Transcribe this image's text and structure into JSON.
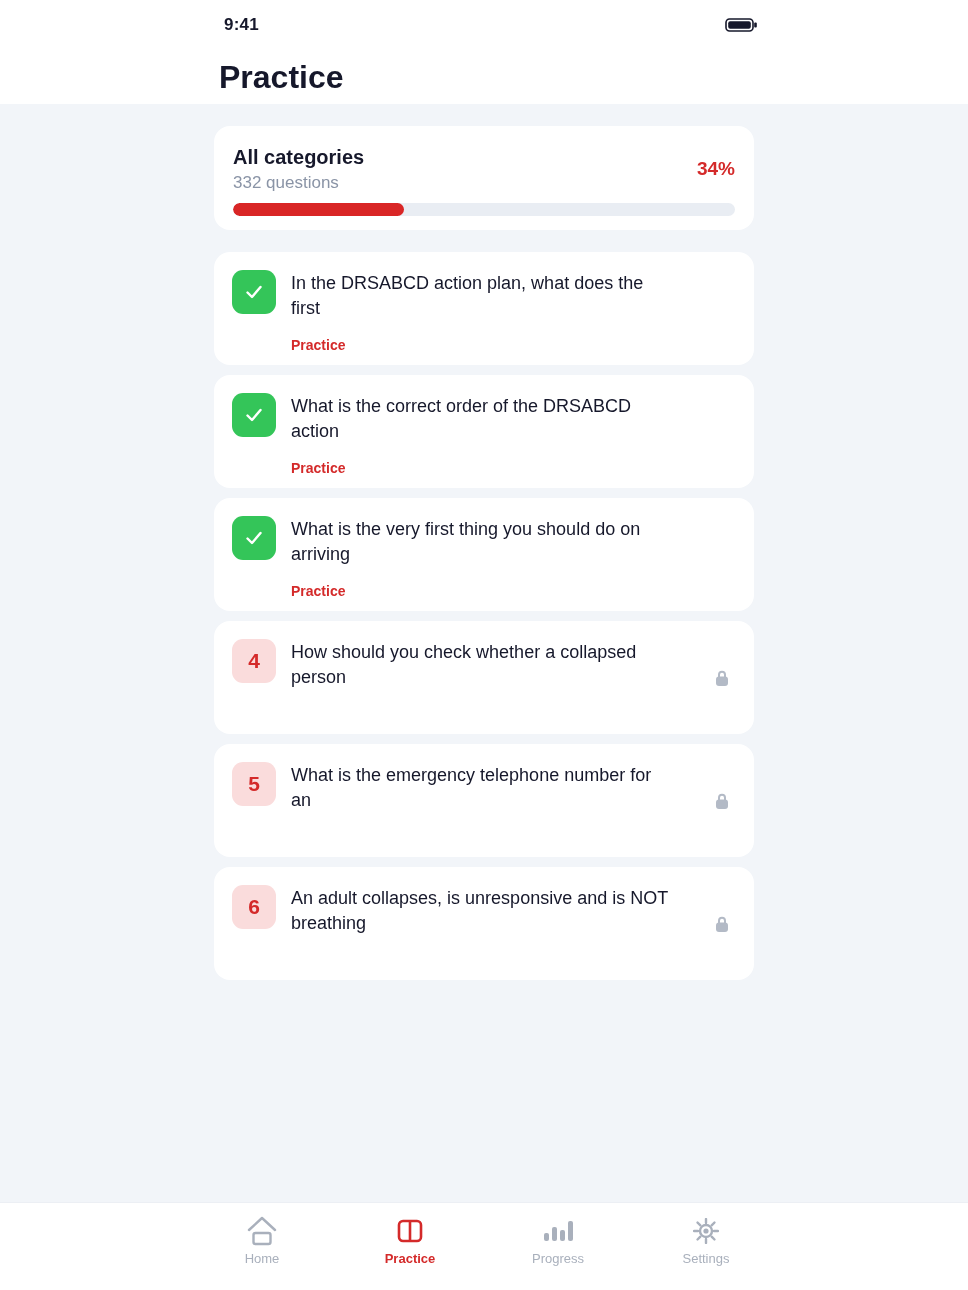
{
  "status_bar": {
    "time": "9:41"
  },
  "header": {
    "title": "Practice"
  },
  "summary": {
    "title": "All categories",
    "subtitle": "332 questions",
    "percent": "34%",
    "level": 0.34
  },
  "questions": [
    {
      "text": "In the DRSABCD action plan, what does the first",
      "completed": true,
      "tag": "Practice",
      "locked": false
    },
    {
      "text": "What is the correct order of the DRSABCD action",
      "completed": true,
      "tag": "Practice",
      "locked": false
    },
    {
      "text": "What is the very first thing you should do on arriving",
      "completed": true,
      "tag": "Practice",
      "locked": false
    },
    {
      "number": "4",
      "text": "How should you check whether a collapsed person",
      "completed": false,
      "locked": true
    },
    {
      "number": "5",
      "text": "What is the emergency telephone number for an",
      "completed": false,
      "locked": true
    },
    {
      "number": "6",
      "text": "An adult collapses, is unresponsive and is NOT breathing",
      "completed": false,
      "locked": true
    }
  ],
  "tab_bar": [
    {
      "label": "Home",
      "selected": false
    },
    {
      "label": "Practice",
      "selected": true
    },
    {
      "label": "Progress",
      "selected": false
    },
    {
      "label": "Settings",
      "selected": false
    }
  ]
}
